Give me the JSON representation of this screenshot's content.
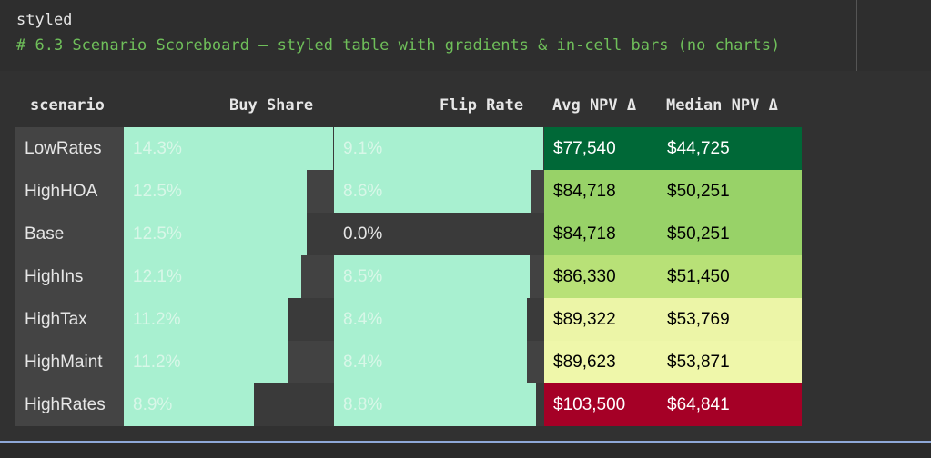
{
  "code": {
    "line1": "styled",
    "line2": "# 6.3 Scenario Scoreboard — styled table with gradients & in-cell bars (no charts)"
  },
  "table": {
    "headers": [
      "scenario",
      "Buy Share",
      "Flip Rate",
      "Avg NPV Δ",
      "Median NPV Δ"
    ],
    "rows": [
      {
        "scenario": "LowRates",
        "buy_share": "14.3%",
        "buy_frac": 1.0,
        "flip_rate": "9.1%",
        "flip_frac": 1.0,
        "avg_npv": "$77,540",
        "median_npv": "$44,725",
        "npv_bg": "#006837",
        "npv_fg": "#ffffff"
      },
      {
        "scenario": "HighHOA",
        "buy_share": "12.5%",
        "buy_frac": 0.874,
        "flip_rate": "8.6%",
        "flip_frac": 0.945,
        "avg_npv": "$84,718",
        "median_npv": "$50,251",
        "npv_bg": "#98d268",
        "npv_fg": "#000000"
      },
      {
        "scenario": "Base",
        "buy_share": "12.5%",
        "buy_frac": 0.874,
        "flip_rate": "0.0%",
        "flip_frac": 0.0,
        "avg_npv": "$84,718",
        "median_npv": "$50,251",
        "npv_bg": "#98d268",
        "npv_fg": "#000000"
      },
      {
        "scenario": "HighIns",
        "buy_share": "12.1%",
        "buy_frac": 0.846,
        "flip_rate": "8.5%",
        "flip_frac": 0.934,
        "avg_npv": "$86,330",
        "median_npv": "$51,450",
        "npv_bg": "#b8e177",
        "npv_fg": "#000000"
      },
      {
        "scenario": "HighTax",
        "buy_share": "11.2%",
        "buy_frac": 0.783,
        "flip_rate": "8.4%",
        "flip_frac": 0.923,
        "avg_npv": "$89,322",
        "median_npv": "$53,769",
        "npv_bg": "#ecf5a7",
        "npv_fg": "#000000"
      },
      {
        "scenario": "HighMaint",
        "buy_share": "11.2%",
        "buy_frac": 0.783,
        "flip_rate": "8.4%",
        "flip_frac": 0.923,
        "avg_npv": "$89,623",
        "median_npv": "$53,871",
        "npv_bg": "#eff7aa",
        "npv_fg": "#000000"
      },
      {
        "scenario": "HighRates",
        "buy_share": "8.9%",
        "buy_frac": 0.622,
        "flip_rate": "8.8%",
        "flip_frac": 0.967,
        "avg_npv": "$103,500",
        "median_npv": "$64,841",
        "npv_bg": "#a50026",
        "npv_fg": "#ffffff"
      }
    ],
    "colors": {
      "bar": "#a8f0d0",
      "bar_text": "#d8f7e8",
      "empty_text": "#e6e6e6",
      "row_even": "#3a3a3a",
      "row_odd": "#424242",
      "scenario_text": "#e6e6e6"
    }
  }
}
